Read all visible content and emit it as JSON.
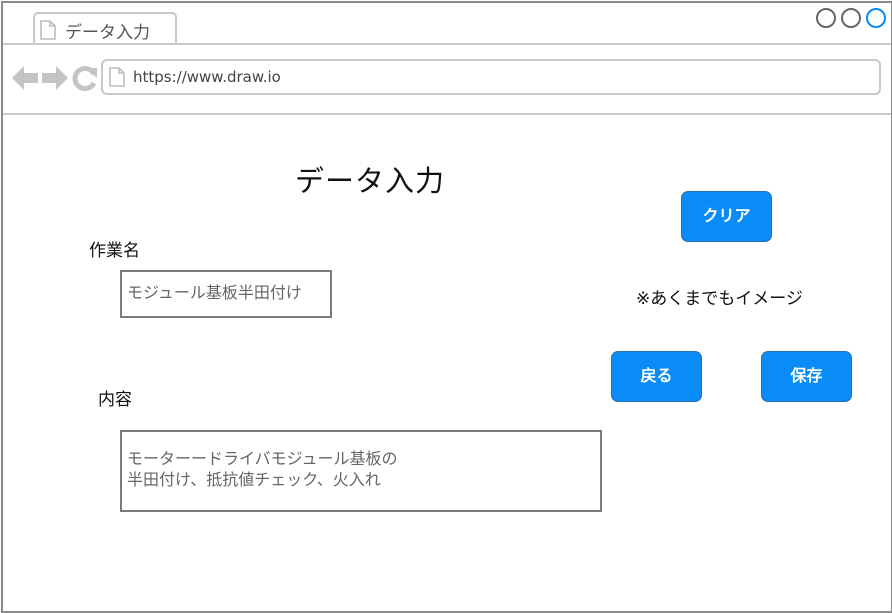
{
  "browser": {
    "tab_title": "データ入力",
    "url": "https://www.draw.io"
  },
  "page": {
    "title": "データ入力",
    "work_name_label": "作業名",
    "work_name_value": "モジュール基板半田付け",
    "content_label": "内容",
    "content_value": "モーターードライバモジュール基板の\n半田付け、抵抗値チェック、火入れ",
    "note": "※あくまでもイメージ",
    "buttons": {
      "clear": "クリア",
      "back": "戻る",
      "save": "保存"
    }
  },
  "colors": {
    "button_bg": "#0a8cf8",
    "window_control_active": "#0a8cf8"
  }
}
